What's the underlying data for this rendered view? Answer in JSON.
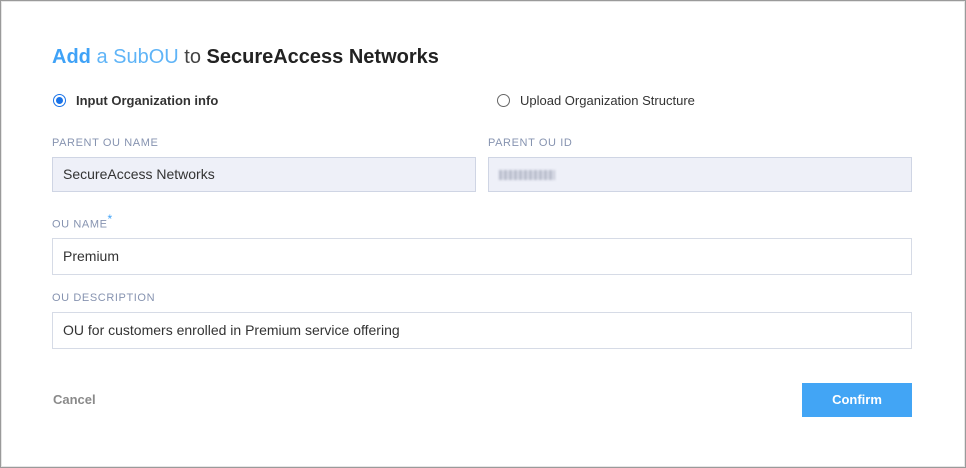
{
  "dialog": {
    "title": {
      "verb": "Add",
      "mid": "a SubOU",
      "to": "to",
      "parent": "SecureAccess Networks"
    },
    "mode_options": [
      {
        "label": "Input Organization info",
        "selected": true
      },
      {
        "label": "Upload Organization Structure",
        "selected": false
      }
    ],
    "fields": {
      "parent_ou_name": {
        "label": "PARENT OU NAME",
        "value": "SecureAccess Networks"
      },
      "parent_ou_id": {
        "label": "PARENT OU ID"
      },
      "ou_name": {
        "label": "OU NAME",
        "required_mark": "*",
        "value": "Premium"
      },
      "ou_description": {
        "label": "OU DESCRIPTION",
        "value": "OU for customers enrolled in Premium service offering"
      }
    },
    "cancel_label": "Cancel",
    "confirm_label": "Confirm"
  }
}
